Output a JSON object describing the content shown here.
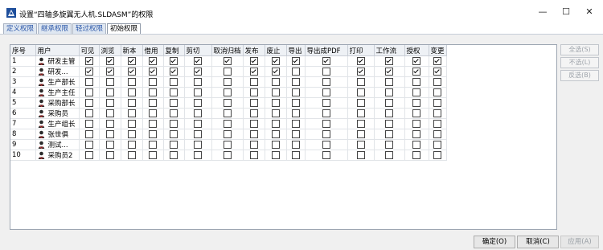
{
  "window": {
    "title": "设置“四轴多旋翼无人机.SLDASM”的权限",
    "controls": {
      "minimize": "—",
      "maximize": "☐",
      "close": "✕"
    }
  },
  "tabs": [
    {
      "label": "定义权限",
      "active": false
    },
    {
      "label": "继承权限",
      "active": false
    },
    {
      "label": "轻过权限",
      "active": false
    },
    {
      "label": "初始权限",
      "active": true
    }
  ],
  "grid": {
    "columns": [
      "序号",
      "用户",
      "可见",
      "浏览",
      "新本",
      "借用",
      "复制",
      "剪切",
      "取消归档",
      "发布",
      "废止",
      "导出",
      "导出成PDF",
      "打印",
      "工作流",
      "授权",
      "变更"
    ],
    "rows": [
      {
        "no": "1",
        "user": "研发主管",
        "perms": [
          1,
          1,
          1,
          1,
          1,
          1,
          1,
          1,
          1,
          1,
          1,
          1,
          1,
          1,
          1
        ]
      },
      {
        "no": "2",
        "user": "研发...",
        "perms": [
          1,
          1,
          1,
          1,
          1,
          1,
          0,
          1,
          1,
          0,
          0,
          1,
          1,
          1,
          1
        ]
      },
      {
        "no": "3",
        "user": "生产部长",
        "perms": [
          0,
          0,
          0,
          0,
          0,
          0,
          0,
          0,
          0,
          0,
          0,
          0,
          0,
          0,
          0
        ]
      },
      {
        "no": "4",
        "user": "生产主任",
        "perms": [
          0,
          0,
          0,
          0,
          0,
          0,
          0,
          0,
          0,
          0,
          0,
          0,
          0,
          0,
          0
        ]
      },
      {
        "no": "5",
        "user": "采购部长",
        "perms": [
          0,
          0,
          0,
          0,
          0,
          0,
          0,
          0,
          0,
          0,
          0,
          0,
          0,
          0,
          0
        ]
      },
      {
        "no": "6",
        "user": "采购员",
        "perms": [
          0,
          0,
          0,
          0,
          0,
          0,
          0,
          0,
          0,
          0,
          0,
          0,
          0,
          0,
          0
        ]
      },
      {
        "no": "7",
        "user": "生产组长",
        "perms": [
          0,
          0,
          0,
          0,
          0,
          0,
          0,
          0,
          0,
          0,
          0,
          0,
          0,
          0,
          0
        ]
      },
      {
        "no": "8",
        "user": "张世俱",
        "perms": [
          0,
          0,
          0,
          0,
          0,
          0,
          0,
          0,
          0,
          0,
          0,
          0,
          0,
          0,
          0
        ]
      },
      {
        "no": "9",
        "user": "测试...",
        "perms": [
          0,
          0,
          0,
          0,
          0,
          0,
          0,
          0,
          0,
          0,
          0,
          0,
          0,
          0,
          0
        ]
      },
      {
        "no": "10",
        "user": "采购员2",
        "perms": [
          0,
          0,
          0,
          0,
          0,
          0,
          0,
          0,
          0,
          0,
          0,
          0,
          0,
          0,
          0
        ]
      }
    ]
  },
  "side_buttons": {
    "select_all": "全选(S)",
    "select_none": "不选(L)",
    "invert": "反选(B)"
  },
  "bottom_buttons": {
    "ok": "确定(O)",
    "cancel": "取消(C)",
    "apply": "应用(A)"
  },
  "colors": {
    "accent": "#2a56a8",
    "checkbox_border": "#444444"
  },
  "icons": {
    "app": "app-icon",
    "user": "user-icon"
  }
}
